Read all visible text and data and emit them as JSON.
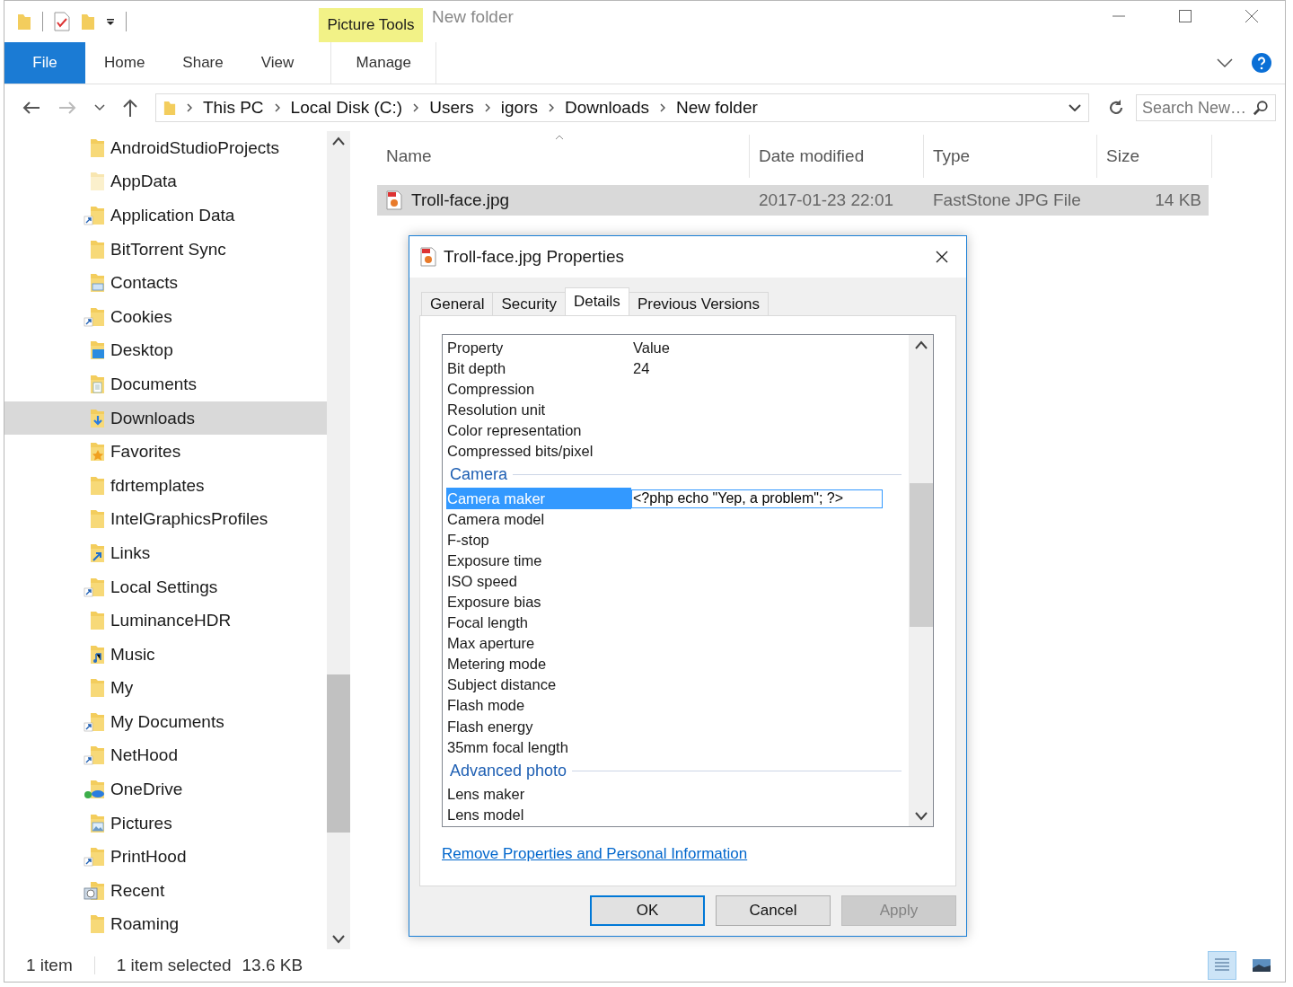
{
  "window": {
    "title": "New folder",
    "contextual_tab_group": "Picture Tools"
  },
  "ribbon_tabs": [
    {
      "label": "File",
      "kind": "file",
      "selected": false
    },
    {
      "label": "Home",
      "kind": "tab",
      "selected": false
    },
    {
      "label": "Share",
      "kind": "tab",
      "selected": false
    },
    {
      "label": "View",
      "kind": "tab",
      "selected": false
    },
    {
      "label": "Manage",
      "kind": "contextual",
      "selected": false
    }
  ],
  "breadcrumbs": [
    "This PC",
    "Local Disk (C:)",
    "Users",
    "igors",
    "Downloads",
    "New folder"
  ],
  "search": {
    "placeholder": "Search New…"
  },
  "navigation": [
    {
      "label": "AndroidStudioProjects",
      "kind": "folder",
      "selected": false
    },
    {
      "label": "AppData",
      "kind": "hidden",
      "selected": false
    },
    {
      "label": "Application Data",
      "kind": "shortcut",
      "selected": false
    },
    {
      "label": "BitTorrent Sync",
      "kind": "folder",
      "selected": false
    },
    {
      "label": "Contacts",
      "kind": "contacts",
      "selected": false
    },
    {
      "label": "Cookies",
      "kind": "shortcut",
      "selected": false
    },
    {
      "label": "Desktop",
      "kind": "desktop",
      "selected": false
    },
    {
      "label": "Documents",
      "kind": "documents",
      "selected": false
    },
    {
      "label": "Downloads",
      "kind": "downloads",
      "selected": true
    },
    {
      "label": "Favorites",
      "kind": "favorites",
      "selected": false
    },
    {
      "label": "fdrtemplates",
      "kind": "folder",
      "selected": false
    },
    {
      "label": "IntelGraphicsProfiles",
      "kind": "folder",
      "selected": false
    },
    {
      "label": "Links",
      "kind": "links",
      "selected": false
    },
    {
      "label": "Local Settings",
      "kind": "shortcut",
      "selected": false
    },
    {
      "label": "LuminanceHDR",
      "kind": "folder",
      "selected": false
    },
    {
      "label": "Music",
      "kind": "music",
      "selected": false
    },
    {
      "label": "My",
      "kind": "folder",
      "selected": false
    },
    {
      "label": "My Documents",
      "kind": "shortcut",
      "selected": false
    },
    {
      "label": "NetHood",
      "kind": "shortcut",
      "selected": false
    },
    {
      "label": "OneDrive",
      "kind": "onedrive",
      "selected": false
    },
    {
      "label": "Pictures",
      "kind": "pictures",
      "selected": false
    },
    {
      "label": "PrintHood",
      "kind": "shortcut",
      "selected": false
    },
    {
      "label": "Recent",
      "kind": "recent",
      "selected": false
    },
    {
      "label": "Roaming",
      "kind": "folder",
      "selected": false
    }
  ],
  "file_table": {
    "columns": [
      "Name",
      "Date modified",
      "Type",
      "Size"
    ],
    "rows": [
      {
        "name": "Troll-face.jpg",
        "date_modified": "2017-01-23 22:01",
        "type": "FastStone JPG File",
        "size": "14 KB",
        "selected": true
      }
    ]
  },
  "status_bar": {
    "item_count": "1 item",
    "selection": "1 item selected",
    "selection_size": "13.6 KB",
    "views": [
      {
        "kind": "details",
        "selected": true
      },
      {
        "kind": "large_icons",
        "selected": false
      }
    ]
  },
  "dialog": {
    "title": "Troll-face.jpg Properties",
    "tabs": [
      {
        "label": "General",
        "selected": false
      },
      {
        "label": "Security",
        "selected": false
      },
      {
        "label": "Details",
        "selected": true
      },
      {
        "label": "Previous Versions",
        "selected": false
      }
    ],
    "columns": [
      "Property",
      "Value"
    ],
    "rows": [
      {
        "kind": "row",
        "property": "Bit depth",
        "value": "24",
        "selected": false
      },
      {
        "kind": "row",
        "property": "Compression",
        "selected": false
      },
      {
        "kind": "row",
        "property": "Resolution unit",
        "selected": false
      },
      {
        "kind": "row",
        "property": "Color representation",
        "selected": false
      },
      {
        "kind": "row",
        "property": "Compressed bits/pixel",
        "selected": false
      },
      {
        "kind": "group",
        "property": "Camera"
      },
      {
        "kind": "row",
        "property": "Camera maker",
        "value": "<?php echo \"Yep, a problem\"; ?>",
        "selected": true
      },
      {
        "kind": "row",
        "property": "Camera model",
        "selected": false
      },
      {
        "kind": "row",
        "property": "F-stop",
        "selected": false
      },
      {
        "kind": "row",
        "property": "Exposure time",
        "selected": false
      },
      {
        "kind": "row",
        "property": "ISO speed",
        "selected": false
      },
      {
        "kind": "row",
        "property": "Exposure bias",
        "selected": false
      },
      {
        "kind": "row",
        "property": "Focal length",
        "selected": false
      },
      {
        "kind": "row",
        "property": "Max aperture",
        "selected": false
      },
      {
        "kind": "row",
        "property": "Metering mode",
        "selected": false
      },
      {
        "kind": "row",
        "property": "Subject distance",
        "selected": false
      },
      {
        "kind": "row",
        "property": "Flash mode",
        "selected": false
      },
      {
        "kind": "row",
        "property": "Flash energy",
        "selected": false
      },
      {
        "kind": "row",
        "property": "35mm focal length",
        "selected": false
      },
      {
        "kind": "group",
        "property": "Advanced photo"
      },
      {
        "kind": "row",
        "property": "Lens maker",
        "selected": false
      },
      {
        "kind": "row",
        "property": "Lens model",
        "selected": false
      }
    ],
    "link": "Remove Properties and Personal Information",
    "buttons": [
      {
        "label": "OK",
        "kind": "default",
        "disabled": false
      },
      {
        "label": "Cancel",
        "kind": "normal",
        "disabled": false
      },
      {
        "label": "Apply",
        "kind": "normal",
        "disabled": true
      }
    ]
  }
}
